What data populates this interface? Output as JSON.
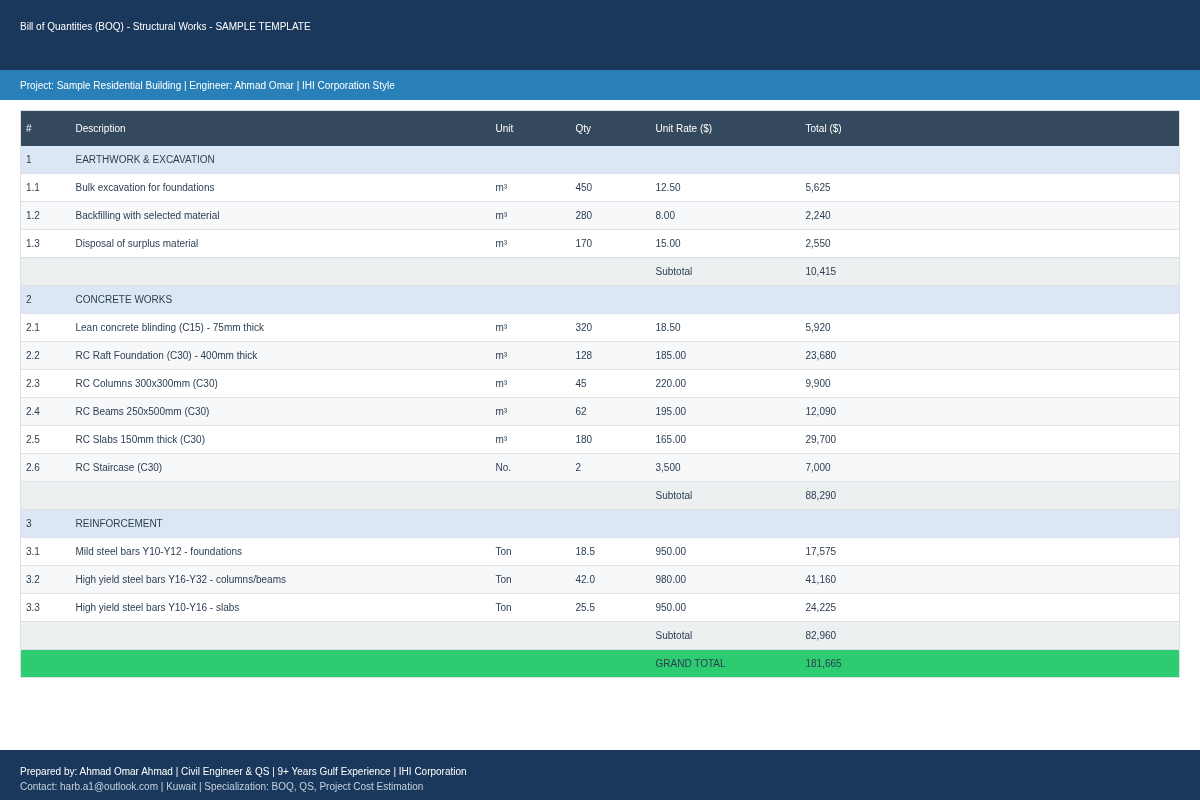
{
  "header": {
    "title": "Bill of Quantities (BOQ) - Structural Works - SAMPLE TEMPLATE",
    "subtitle": "Project: Sample Residential Building | Engineer: Ahmad Omar | IHI Corporation Style"
  },
  "table": {
    "columns": [
      "#",
      "Description",
      "Unit",
      "Qty",
      "Unit Rate ($)",
      "Total ($)"
    ],
    "rows": [
      {
        "kind": "section",
        "cells": [
          "1",
          "EARTHWORK & EXCAVATION"
        ]
      },
      {
        "kind": "item",
        "cells": [
          "1.1",
          "Bulk excavation for foundations",
          "m³",
          "450",
          "12.50",
          "5,625"
        ]
      },
      {
        "kind": "item",
        "cells": [
          "1.2",
          "Backfilling with selected material",
          "m³",
          "280",
          "8.00",
          "2,240"
        ]
      },
      {
        "kind": "item",
        "cells": [
          "1.3",
          "Disposal of surplus material",
          "m³",
          "170",
          "15.00",
          "2,550"
        ]
      },
      {
        "kind": "subtotal",
        "cells": [
          "Subtotal",
          "10,415"
        ]
      },
      {
        "kind": "section",
        "cells": [
          "2",
          "CONCRETE WORKS"
        ]
      },
      {
        "kind": "item",
        "cells": [
          "2.1",
          "Lean concrete blinding (C15) - 75mm thick",
          "m³",
          "320",
          "18.50",
          "5,920"
        ]
      },
      {
        "kind": "item",
        "cells": [
          "2.2",
          "RC Raft Foundation (C30) - 400mm thick",
          "m³",
          "128",
          "185.00",
          "23,680"
        ]
      },
      {
        "kind": "item",
        "cells": [
          "2.3",
          "RC Columns 300x300mm (C30)",
          "m³",
          "45",
          "220.00",
          "9,900"
        ]
      },
      {
        "kind": "item",
        "cells": [
          "2.4",
          "RC Beams 250x500mm (C30)",
          "m³",
          "62",
          "195.00",
          "12,090"
        ]
      },
      {
        "kind": "item",
        "cells": [
          "2.5",
          "RC Slabs 150mm thick (C30)",
          "m³",
          "180",
          "165.00",
          "29,700"
        ]
      },
      {
        "kind": "item",
        "cells": [
          "2.6",
          "RC Staircase (C30)",
          "No.",
          "2",
          "3,500",
          "7,000"
        ]
      },
      {
        "kind": "subtotal",
        "cells": [
          "Subtotal",
          "88,290"
        ]
      },
      {
        "kind": "section",
        "cells": [
          "3",
          "REINFORCEMENT"
        ]
      },
      {
        "kind": "item",
        "cells": [
          "3.1",
          "Mild steel bars Y10-Y12 - foundations",
          "Ton",
          "18.5",
          "950.00",
          "17,575"
        ]
      },
      {
        "kind": "item",
        "cells": [
          "3.2",
          "High yield steel bars Y16-Y32 - columns/beams",
          "Ton",
          "42.0",
          "980.00",
          "41,160"
        ]
      },
      {
        "kind": "item",
        "cells": [
          "3.3",
          "High yield steel bars Y10-Y16 - slabs",
          "Ton",
          "25.5",
          "950.00",
          "24,225"
        ]
      },
      {
        "kind": "subtotal",
        "cells": [
          "Subtotal",
          "82,960"
        ]
      },
      {
        "kind": "grand_total",
        "cells": [
          "GRAND TOTAL",
          "181,665"
        ]
      }
    ]
  },
  "footer": {
    "line_1": "Prepared by: Ahmad Omar Ahmad | Civil Engineer & QS | 9+ Years Gulf Experience | IHI Corporation",
    "line_2": "Contact: harb.a1@outlook.com | Kuwait | Specialization: BOQ, QS, Project Cost Estimation"
  }
}
